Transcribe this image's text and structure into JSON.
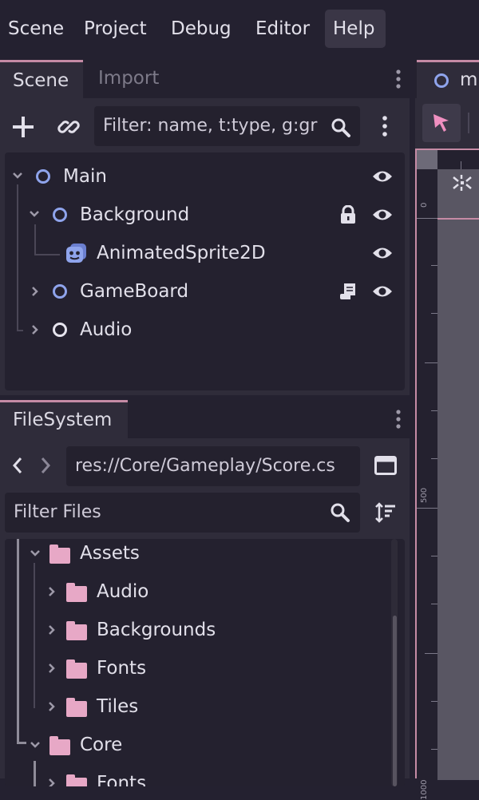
{
  "menu": [
    "Scene",
    "Project",
    "Debug",
    "Editor",
    "Help"
  ],
  "scene_dock": {
    "tabs": [
      "Scene",
      "Import"
    ],
    "filter_placeholder": "Filter: name, t:type, g:gr",
    "nodes": [
      "Main",
      "Background",
      "AnimatedSprite2D",
      "GameBoard",
      "Audio"
    ]
  },
  "filesystem_dock": {
    "tab": "FileSystem",
    "path": "res://Core/Gameplay/Score.cs",
    "filter_placeholder": "Filter Files",
    "items": [
      "Assets",
      "Audio",
      "Backgrounds",
      "Fonts",
      "Tiles",
      "Core",
      "Fonts"
    ]
  },
  "viewport": {
    "tab_label": "m",
    "ruler_labels": [
      "0",
      "500",
      "1000"
    ]
  },
  "colors": {
    "accent": "#c58ba5",
    "node_2d": "#8fa4ec",
    "folder": "#e7a8c6",
    "panel": "#2f2c3a",
    "base": "#242130"
  },
  "icons": [
    "add-icon",
    "link-icon",
    "search-icon",
    "kebab-menu-icon",
    "eye-icon",
    "lock-icon",
    "script-icon",
    "sprite-icon",
    "chevron-icon",
    "folder-icon",
    "sort-icon",
    "split-icon",
    "select-cursor-icon",
    "center-view-icon"
  ]
}
